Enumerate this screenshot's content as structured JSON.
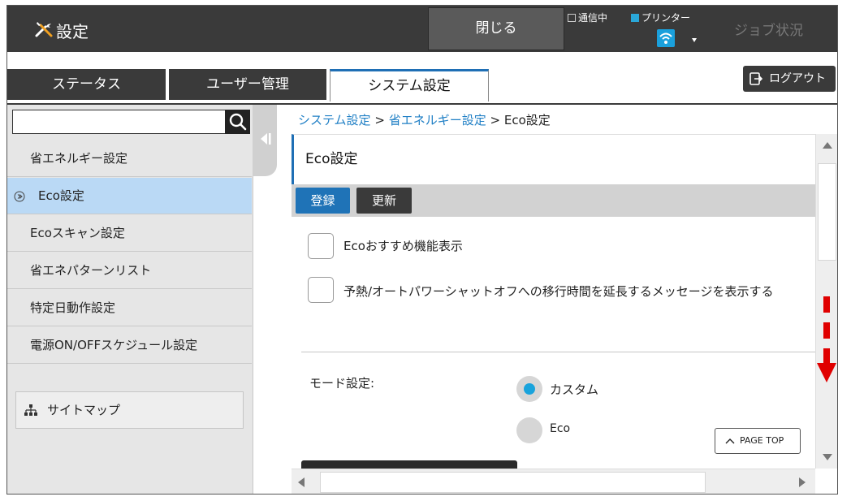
{
  "header": {
    "title": "設定",
    "close_label": "閉じる",
    "status_comm": "通信中",
    "status_printer": "プリンター",
    "job_status": "ジョブ状況"
  },
  "tabs": [
    {
      "label": "ステータス"
    },
    {
      "label": "ユーザー管理"
    },
    {
      "label": "システム設定"
    }
  ],
  "logout_label": "ログアウト",
  "sidebar": {
    "search_value": "",
    "items": [
      {
        "label": "省エネルギー設定"
      },
      {
        "label": "Eco設定"
      },
      {
        "label": "Ecoスキャン設定"
      },
      {
        "label": "省エネパターンリスト"
      },
      {
        "label": "特定日動作設定"
      },
      {
        "label": "電源ON/OFFスケジュール設定"
      }
    ],
    "sitemap_label": "サイトマップ"
  },
  "breadcrumb": {
    "part1": "システム設定",
    "sep": ">",
    "part2": "省エネルギー設定",
    "part3": "Eco設定"
  },
  "main": {
    "title": "Eco設定",
    "register_label": "登録",
    "update_label": "更新",
    "checkbox1_label": "Ecoおすすめ機能表示",
    "checkbox2_label": "予熱/オートパワーシャットオフへの移行時間を延長するメッセージを表示する",
    "mode_label": "モード設定:",
    "radio_custom": "カスタム",
    "radio_eco": "Eco",
    "page_top_label": "PAGE TOP"
  },
  "colors": {
    "accent": "#1f73b7",
    "selected_bg": "#bad9f5",
    "radio_on": "#19a3dc",
    "scroll_hint": "#e00000"
  }
}
